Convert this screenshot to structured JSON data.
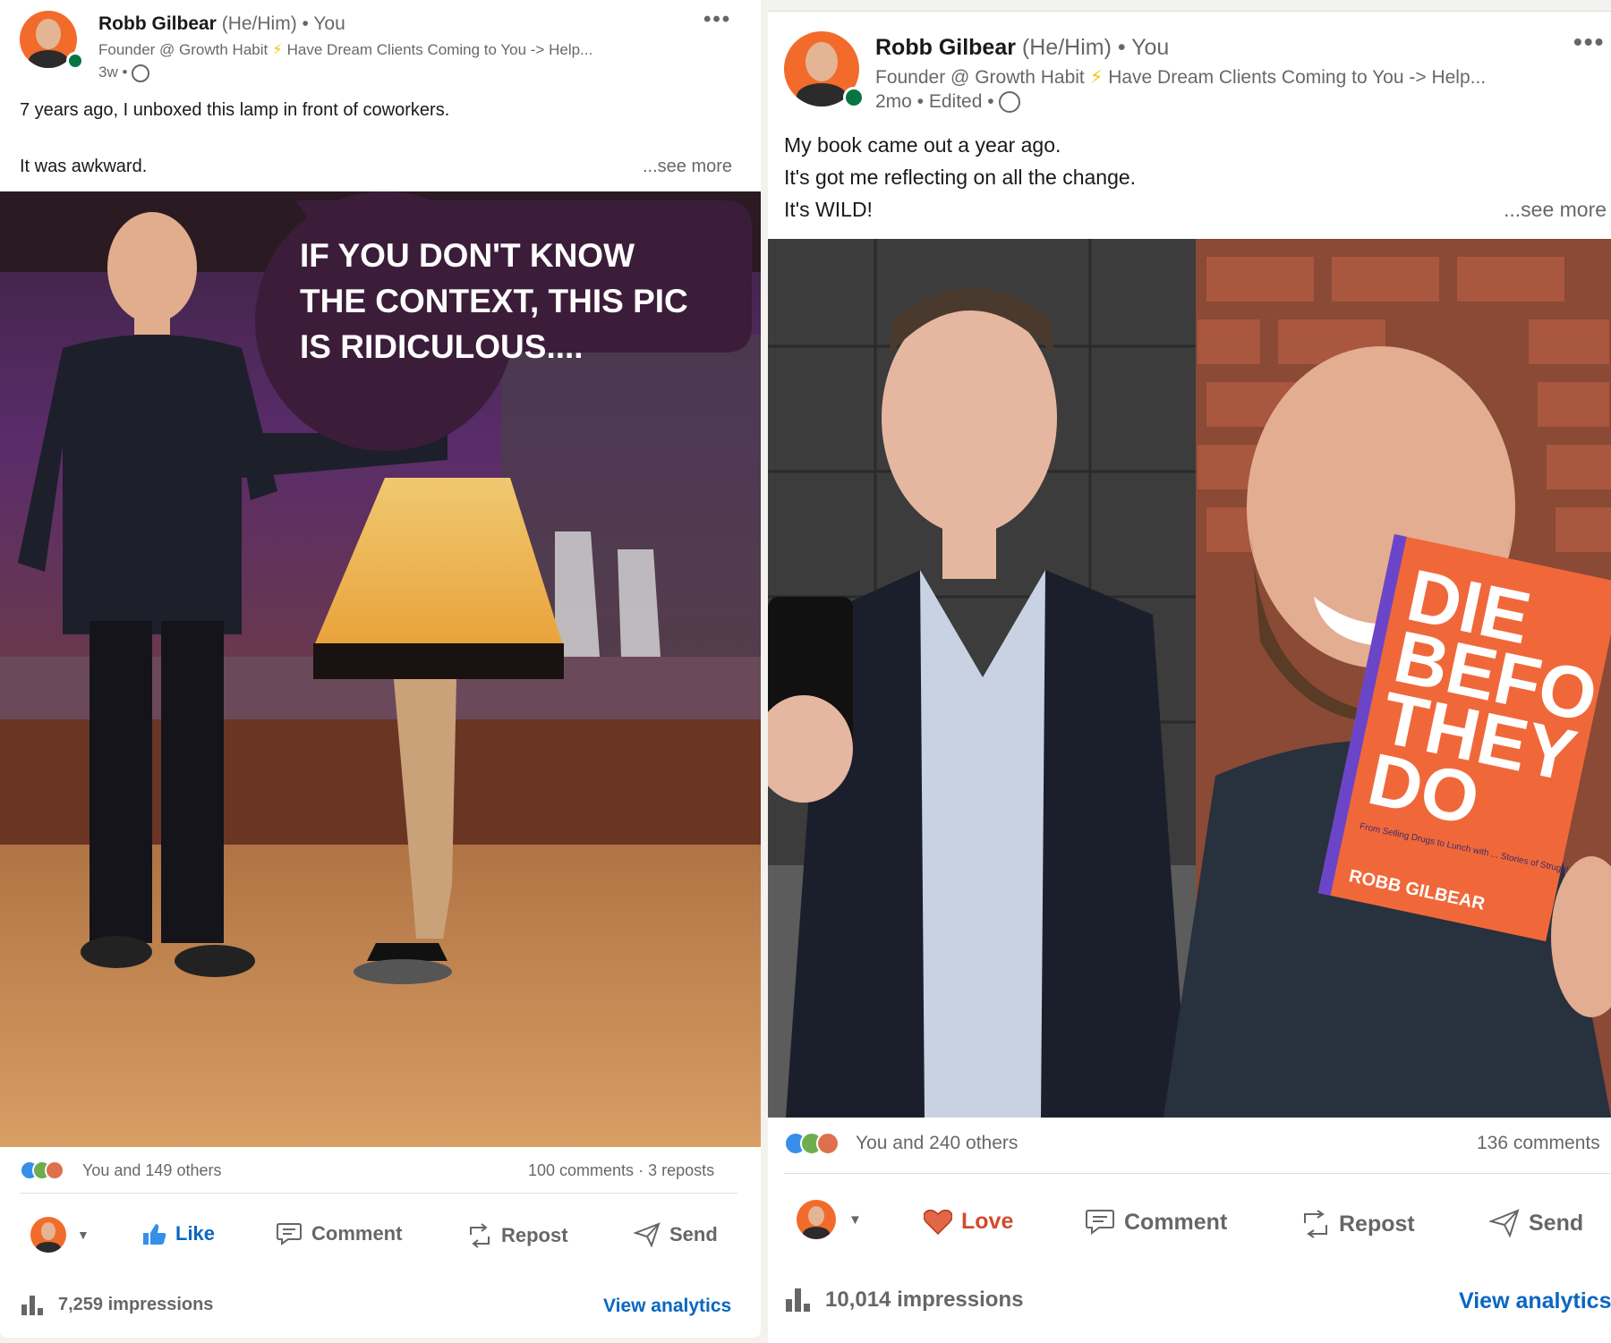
{
  "posts": [
    {
      "author": "Robb Gilbear",
      "pronouns": "(He/Him)",
      "you": "• You",
      "headline_a": "Founder @ Growth Habit",
      "headline_bolt": "⚡",
      "headline_b": "Have Dream Clients Coming to You -> Help...",
      "time": "3w •",
      "text_lines": [
        "7 years ago, I unboxed this lamp in front of coworkers.",
        "",
        "It was awkward."
      ],
      "see_more": "...see more",
      "image_caption_lines": [
        "IF YOU DON'T KNOW",
        "THE CONTEXT, THIS PIC",
        "IS RIDICULOUS...."
      ],
      "reactions_text": "You and 149 others",
      "comments": "100 comments",
      "reposts": "3 reposts",
      "actions": {
        "like": "Like",
        "comment": "Comment",
        "repost": "Repost",
        "send": "Send"
      },
      "impressions": "7,259 impressions",
      "view_analytics": "View analytics"
    },
    {
      "author": "Robb Gilbear",
      "pronouns": "(He/Him)",
      "you": "• You",
      "headline_a": "Founder @ Growth Habit",
      "headline_bolt": "⚡",
      "headline_b": "Have Dream Clients Coming to You -> Help...",
      "time": "2mo • Edited •",
      "text_lines": [
        "My book came out a year ago.",
        "It's got me reflecting on all the change.",
        "It's WILD!"
      ],
      "see_more": "...see more",
      "book_title_lines": [
        "DIE",
        "BEFO",
        "THEY",
        "DO"
      ],
      "book_subtitle": "From Selling Drugs to Lunch with ... Stories of Struggle, Near Death Exp... and Creating a Life With Meaning.",
      "book_author": "ROBB GILBEAR",
      "reactions_text": "You and 240 others",
      "comments": "136 comments",
      "actions": {
        "love": "Love",
        "comment": "Comment",
        "repost": "Repost",
        "send": "Send"
      },
      "impressions": "10,014 impressions",
      "view_analytics": "View analytics"
    }
  ],
  "colors": {
    "brand_blue": "#0a66c2",
    "love_red": "#d44a2b",
    "online_green": "#057642",
    "avatar_orange": "#f26b2b"
  },
  "icons": [
    "more-dots-icon",
    "globe-icon",
    "like-icon",
    "love-icon",
    "comment-icon",
    "repost-icon",
    "send-icon",
    "analytics-bars-icon",
    "caret-down-icon"
  ]
}
